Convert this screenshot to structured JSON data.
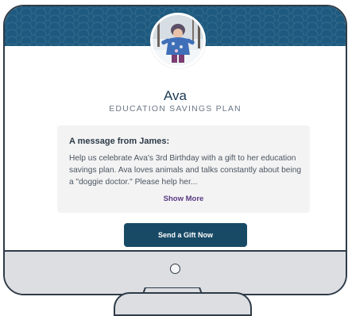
{
  "profile": {
    "name": "Ava",
    "plan": "EDUCATION SAVINGS PLAN"
  },
  "message": {
    "title": "A message from James:",
    "body": "Help us celebrate Ava's 3rd Birthday with a gift to her education savings plan. Ava loves animals and talks constantly about being a \"doggie doctor.\" Please help her...",
    "show_more_label": "Show More"
  },
  "cta": {
    "label": "Send a Gift Now"
  },
  "colors": {
    "banner": "#1e5a7f",
    "button": "#184a66",
    "link": "#5a3a82",
    "card": "#f3f3f4",
    "bezel_outline": "#2f3b47",
    "chin": "#dcdee2"
  },
  "icons": {
    "power": "power-button-icon"
  }
}
